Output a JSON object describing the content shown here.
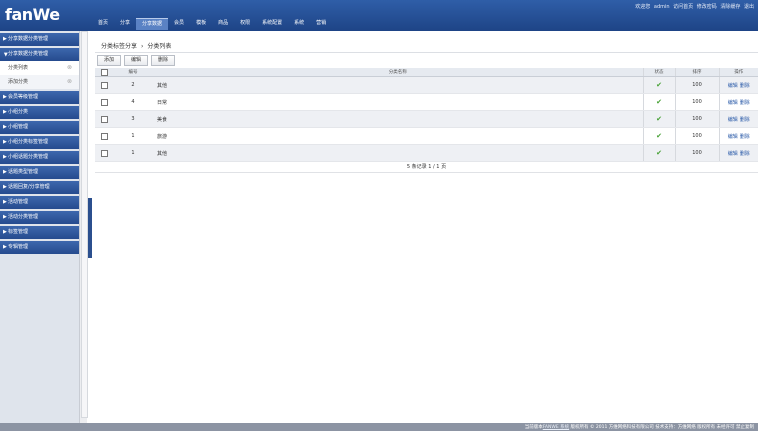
{
  "app": {
    "logo": "fanWe",
    "top_links": [
      "欢迎您",
      "admin",
      "访问首页",
      "修改密码",
      "清除缓存",
      "退出"
    ]
  },
  "main_nav": [
    "首页",
    "分享",
    "分享数据",
    "会员",
    "模板",
    "商品",
    "权限",
    "系统配置",
    "系统",
    "营销"
  ],
  "sidebar": {
    "items": [
      {
        "label": "分享数据分类管理",
        "expanded": false
      },
      {
        "label": "分享数据分类管理",
        "expanded": true
      },
      {
        "label": "会员等级管理",
        "expanded": false
      },
      {
        "label": "小组分类",
        "expanded": false
      },
      {
        "label": "小组管理",
        "expanded": false
      },
      {
        "label": "小组分类标签管理",
        "expanded": false
      },
      {
        "label": "小组话题分类管理",
        "expanded": false
      },
      {
        "label": "话题类型管理",
        "expanded": false
      },
      {
        "label": "话题回复/分享管理",
        "expanded": false
      },
      {
        "label": "活动管理",
        "expanded": false
      },
      {
        "label": "活动分类管理",
        "expanded": false
      },
      {
        "label": "标签管理",
        "expanded": false
      },
      {
        "label": "专辑管理",
        "expanded": false
      }
    ],
    "subitems": [
      "分类列表",
      "添加分类"
    ]
  },
  "breadcrumb": {
    "parent": "分类标签分享",
    "current": "分类列表"
  },
  "toolbar": {
    "add": "添加",
    "edit": "编辑",
    "delete": "删除"
  },
  "table": {
    "headers": {
      "id": "编号",
      "name": "分类名称",
      "status": "状态",
      "sort": "排序",
      "op": "操作"
    },
    "rows": [
      {
        "id": "2",
        "name": "其他",
        "sort": "100",
        "edit": "编辑",
        "delete": "删除"
      },
      {
        "id": "4",
        "name": "日常",
        "sort": "100",
        "edit": "编辑",
        "delete": "删除"
      },
      {
        "id": "3",
        "name": "美食",
        "sort": "100",
        "edit": "编辑",
        "delete": "删除"
      },
      {
        "id": "1",
        "name": "旅游",
        "sort": "100",
        "edit": "编辑",
        "delete": "删除"
      },
      {
        "id": "1",
        "name": "其他",
        "sort": "100",
        "edit": "编辑",
        "delete": "删除"
      }
    ]
  },
  "pager": "5 条记录 1 / 1 页",
  "footer": {
    "prefix": "当前版本",
    "link": "FANWE 系统",
    "rest": " 版权所有 © 2011 方维网络科技有限公司 技术支持：方维网络 版权所有 未经许可 禁止复制"
  },
  "colors": {
    "accent": "#1e4486",
    "ok": "#44a032"
  }
}
